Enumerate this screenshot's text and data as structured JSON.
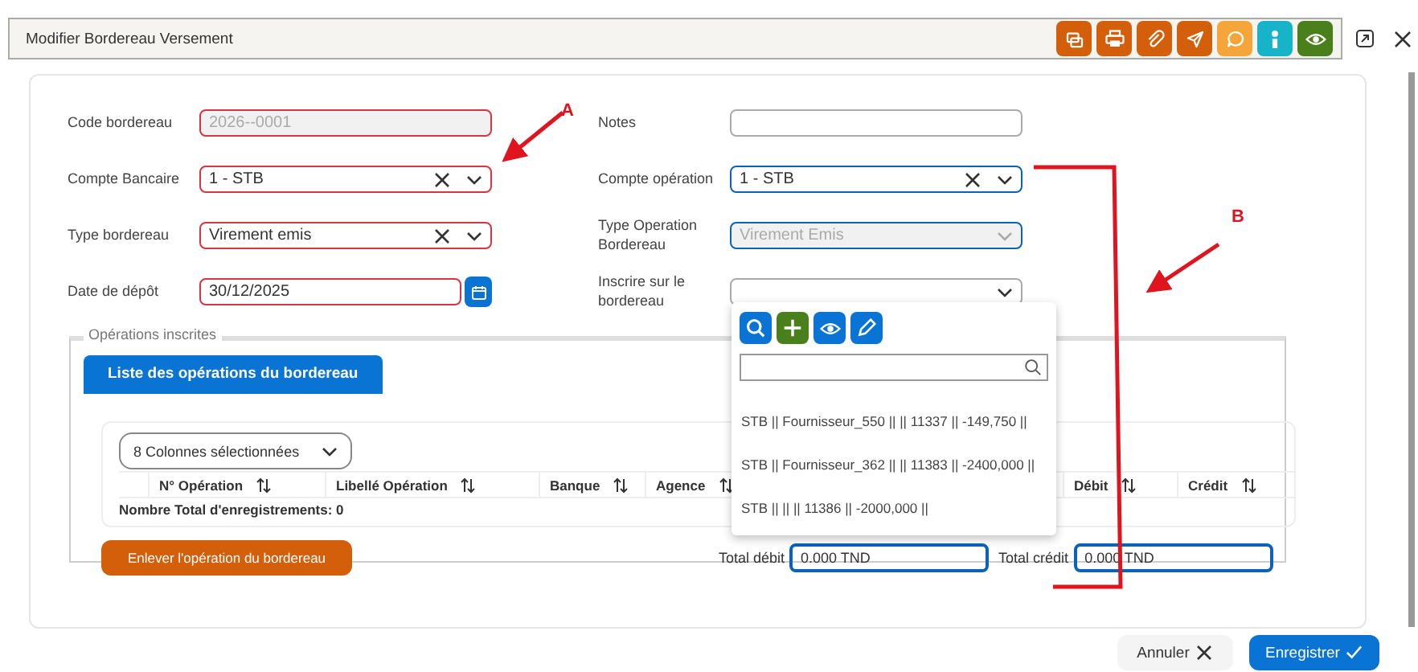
{
  "window": {
    "title": "Modifier Bordereau Versement"
  },
  "toolbar": [
    {
      "color": "#d35f0a"
    },
    {
      "color": "#d35f0a"
    },
    {
      "color": "#d35f0a"
    },
    {
      "color": "#d35f0a"
    },
    {
      "color": "#f5a53a"
    },
    {
      "color": "#17b3c8"
    },
    {
      "color": "#4a801b"
    }
  ],
  "form": {
    "left": [
      {
        "label": "Code bordereau",
        "value": "2026--0001",
        "kind": "text",
        "invalid": true,
        "highlighted": false,
        "disabled": true
      },
      {
        "label": "Compte Bancaire",
        "value": "1 - STB",
        "kind": "select",
        "clearable": true,
        "invalid": true,
        "highlighted": false,
        "disabled": false
      },
      {
        "label": "Type bordereau",
        "value": "Virement emis",
        "kind": "select",
        "clearable": true,
        "invalid": true,
        "highlighted": false,
        "disabled": false
      },
      {
        "label": "Date de dépôt",
        "value": "30/12/2025",
        "kind": "date",
        "invalid": true,
        "highlighted": false,
        "disabled": false
      }
    ],
    "right": [
      {
        "label": "Notes",
        "kind": "text",
        "invalid": false,
        "highlighted": false,
        "disabled": false
      },
      {
        "label": "Compte opération",
        "value": "1 - STB",
        "kind": "select",
        "clearable": true,
        "invalid": false,
        "highlighted": true,
        "disabled": false
      },
      {
        "label": "Type Operation Bordereau",
        "value": "Virement Emis",
        "kind": "select",
        "clearable": false,
        "invalid": false,
        "highlighted": true,
        "disabled": true
      },
      {
        "label": "Inscrire sur le bordereau",
        "kind": "select",
        "clearable": false,
        "invalid": false,
        "highlighted": false,
        "disabled": false
      }
    ]
  },
  "dropdown": {
    "actions": [
      {
        "color": "#0a74d4"
      },
      {
        "color": "#4a801b"
      },
      {
        "color": "#0a74d4"
      },
      {
        "color": "#0a74d4"
      }
    ],
    "options": [
      "STB || Fournisseur_550 || || 11337 || -149,750 ||",
      "STB || Fournisseur_362 || || 11383 || -2400,000 ||",
      "STB || || || 11386 || -2000,000 ||"
    ]
  },
  "section": {
    "legend": "Opérations inscrites",
    "tab": {
      "label": "Liste des opérations du bordereau",
      "selected": true
    },
    "column_picker": "8 Colonnes sélectionnées",
    "columns": [
      "N° Opération",
      "Libellé Opération",
      "Banque",
      "Agence",
      "Débit",
      "Crédit"
    ],
    "record_count": "Nombre Total d'enregistrements: 0",
    "remove_button": "Enlever l'opération du bordereau",
    "totals": [
      {
        "label": "Total débit",
        "value": "0.000 TND"
      },
      {
        "label": "Total crédit",
        "value": "0.000 TND"
      }
    ]
  },
  "buttons": [
    {
      "label": "Annuler",
      "kind": "cancel"
    },
    {
      "label": "Enregistrer",
      "kind": "save"
    }
  ],
  "annotations": [
    {
      "label": "A"
    },
    {
      "label": "B"
    }
  ]
}
